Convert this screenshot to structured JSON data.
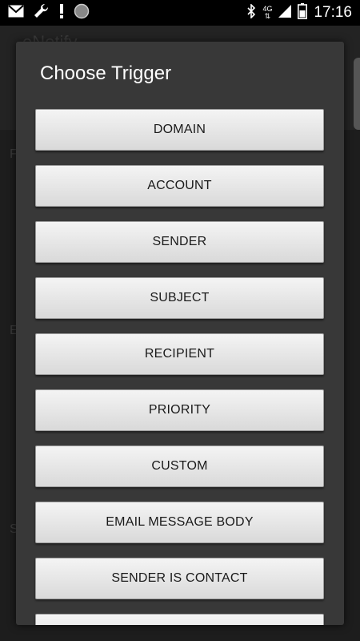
{
  "status_bar": {
    "time": "17:16",
    "network_type": "4G",
    "icons": [
      "gmail-icon",
      "wrench-icon",
      "alert-icon",
      "circle-icon",
      "bluetooth-icon",
      "signal-icon",
      "battery-icon"
    ]
  },
  "background_app": {
    "title": "eNotify",
    "labels": [
      "F",
      "E",
      "S"
    ]
  },
  "dialog": {
    "title": "Choose Trigger",
    "options": [
      "DOMAIN",
      "ACCOUNT",
      "SENDER",
      "SUBJECT",
      "RECIPIENT",
      "PRIORITY",
      "CUSTOM",
      "EMAIL MESSAGE BODY",
      "SENDER IS CONTACT",
      ""
    ]
  }
}
